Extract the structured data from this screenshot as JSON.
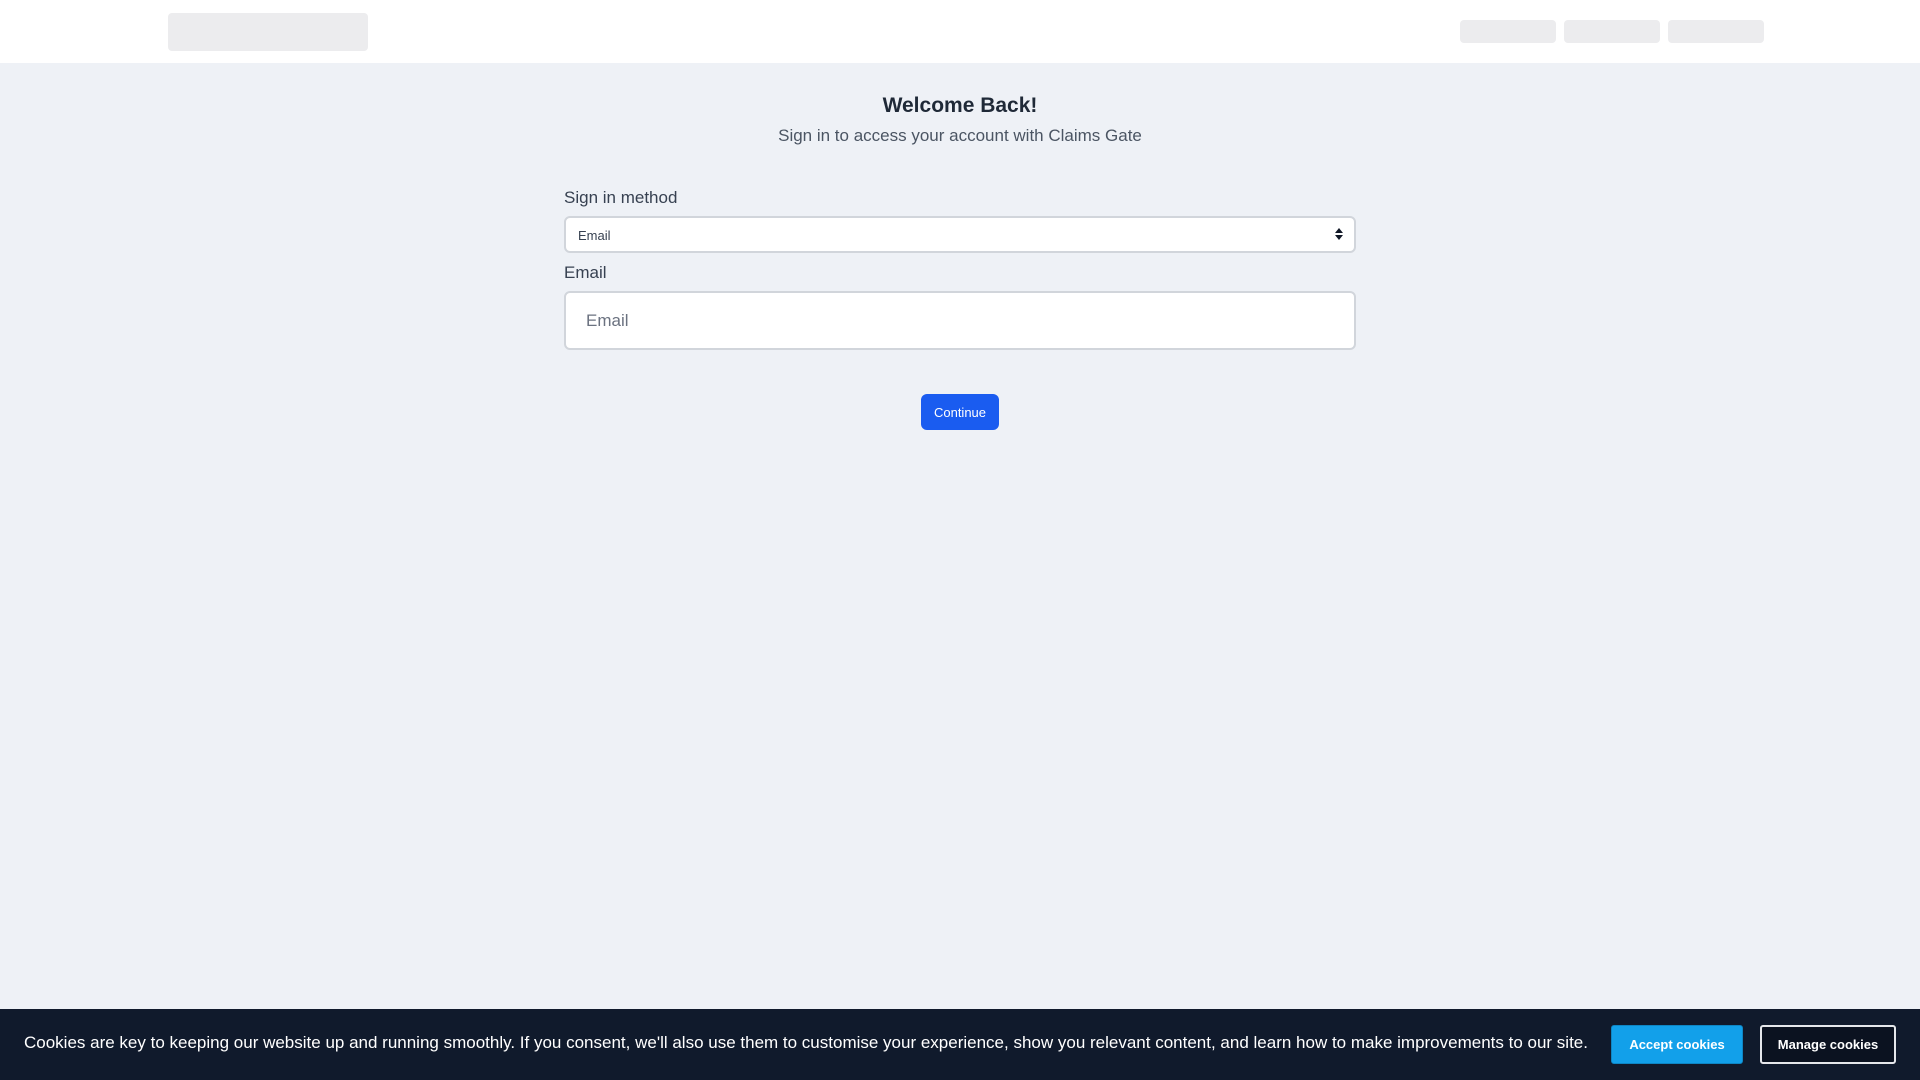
{
  "login": {
    "title": "Welcome Back!",
    "subtitle": "Sign in to access your account with Claims Gate",
    "method_label": "Sign in method",
    "method_value": "Email",
    "email_label": "Email",
    "email_placeholder": "Email",
    "email_value": "",
    "continue_label": "Continue"
  },
  "cookie_banner": {
    "text": "Cookies are key to keeping our website up and running smoothly. If you consent, we'll also use them to customise your experience, show you relevant content, and learn how to make improvements to our site.",
    "accept_label": "Accept cookies",
    "manage_label": "Manage cookies"
  },
  "colors": {
    "page_background": "#eef1f6",
    "primary_button": "#1a5cf0",
    "accept_button": "#12a0ea",
    "banner_background": "#101a2c"
  }
}
